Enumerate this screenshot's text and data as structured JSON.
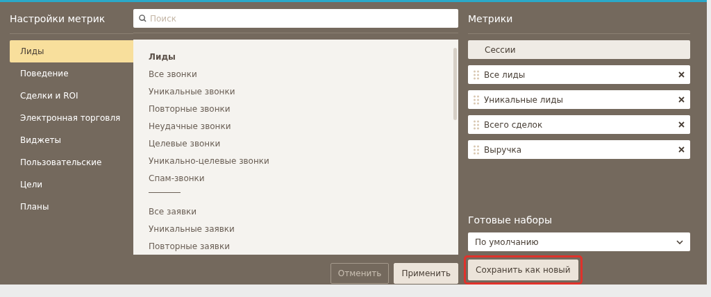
{
  "title": "Настройки метрик",
  "search": {
    "placeholder": "Поиск"
  },
  "categories": [
    {
      "label": "Лиды",
      "selected": true
    },
    {
      "label": "Поведение",
      "selected": false
    },
    {
      "label": "Сделки и ROI",
      "selected": false
    },
    {
      "label": "Электронная торговля",
      "selected": false
    },
    {
      "label": "Виджеты",
      "selected": false
    },
    {
      "label": "Пользовательские",
      "selected": false
    },
    {
      "label": "Цели",
      "selected": false
    },
    {
      "label": "Планы",
      "selected": false
    }
  ],
  "available": [
    {
      "kind": "header",
      "label": "Лиды"
    },
    {
      "kind": "item",
      "label": "Все звонки"
    },
    {
      "kind": "item",
      "label": "Уникальные звонки"
    },
    {
      "kind": "item",
      "label": "Повторные звонки"
    },
    {
      "kind": "item",
      "label": "Неудачные звонки"
    },
    {
      "kind": "item",
      "label": "Целевые звонки"
    },
    {
      "kind": "item",
      "label": "Уникально-целевые звонки"
    },
    {
      "kind": "item",
      "label": "Спам-звонки"
    },
    {
      "kind": "separator"
    },
    {
      "kind": "item",
      "label": "Все заявки"
    },
    {
      "kind": "item",
      "label": "Уникальные заявки"
    },
    {
      "kind": "item",
      "label": "Повторные заявки"
    }
  ],
  "metrics_title": "Метрики",
  "metrics": [
    {
      "kind": "fixed",
      "label": "Сессии"
    },
    {
      "kind": "removable",
      "label": "Все лиды"
    },
    {
      "kind": "removable",
      "label": "Уникальные лиды"
    },
    {
      "kind": "removable",
      "label": "Всего сделок"
    },
    {
      "kind": "removable",
      "label": "Выручка"
    }
  ],
  "presets_title": "Готовые наборы",
  "preset": {
    "value": "По умолчанию"
  },
  "buttons": [
    {
      "kind": "outline",
      "label": "Отменить"
    },
    {
      "kind": "filled",
      "label": "Применить"
    }
  ],
  "save_button": {
    "label": "Сохранить как новый",
    "highlighted": true
  }
}
